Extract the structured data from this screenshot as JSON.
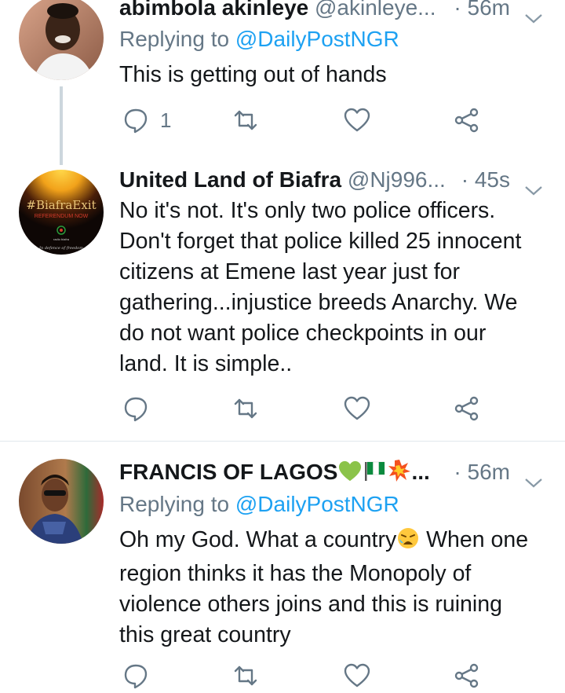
{
  "tweets": [
    {
      "display_name": "abimbola akinleye",
      "handle": "@akinleye...",
      "time": "· 56m",
      "replying_label": "Replying to",
      "replying_handle": "@DailyPostNGR",
      "text": "This is getting out of hands",
      "reply_count": "1",
      "retweet_count": "",
      "like_count": ""
    },
    {
      "display_name": "United Land of Biafra",
      "handle": "@Nj996...",
      "time": "· 45s",
      "avatar_text": "#BiafraExit",
      "avatar_subtext": "REFERENDUM NOW",
      "avatar_caption": "radio biafra",
      "avatar_footer": "In defence of freedom",
      "text_lines": [
        "No it's not. It's only two police officers.",
        "Don't forget that police killed 25 innocent",
        "citizens at Emene last year just for",
        "gathering...injustice breeds Anarchy. We",
        "do not want police checkpoints in our",
        "land. It is simple.."
      ]
    },
    {
      "display_name": "FRANCIS OF LAGOS",
      "name_suffix": "...",
      "time": "· 56m",
      "replying_label": "Replying to",
      "replying_handle": "@DailyPostNGR",
      "line1_a": "Oh my God. What a country",
      "line1_b": " When one",
      "text_lines": [
        "region thinks it has the Monopoly of",
        "violence others joins and this is ruining",
        "this great country"
      ]
    }
  ],
  "colors": {
    "accent": "#1da1f2",
    "secondary_text": "#657786",
    "primary_text": "#14171a",
    "thread_line": "#ccd6dd",
    "divider": "#e1e8ed"
  },
  "icons": [
    "reply-icon",
    "retweet-icon",
    "like-icon",
    "share-icon",
    "chevron-down-icon"
  ]
}
